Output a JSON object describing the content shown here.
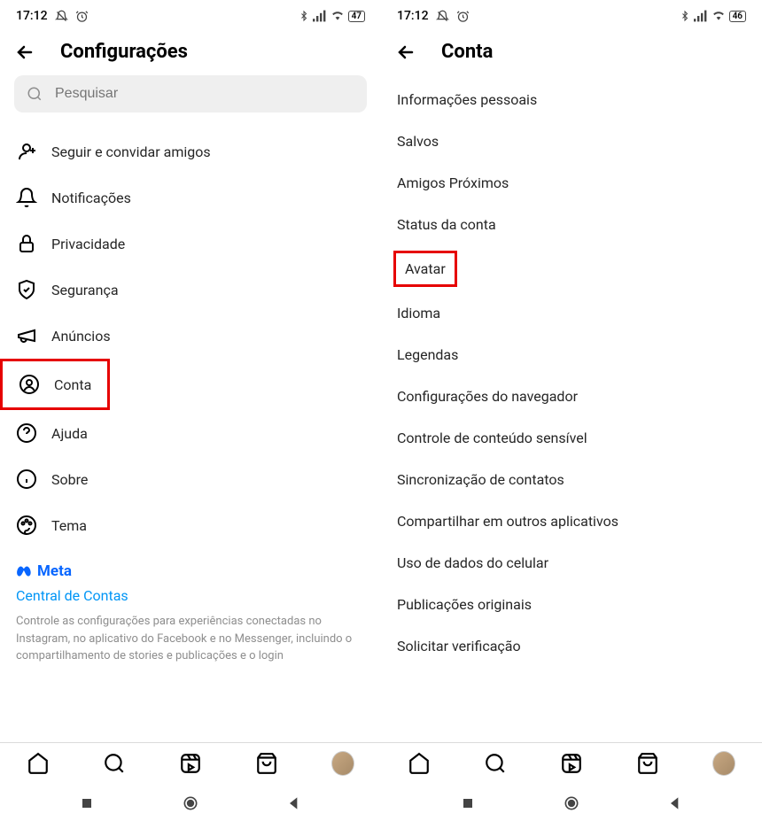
{
  "left": {
    "statusBar": {
      "time": "17:12",
      "battery": "47"
    },
    "header": {
      "title": "Configurações"
    },
    "search": {
      "placeholder": "Pesquisar"
    },
    "items": [
      {
        "icon": "follow-icon",
        "label": "Seguir e convidar amigos"
      },
      {
        "icon": "bell-icon",
        "label": "Notificações"
      },
      {
        "icon": "lock-icon",
        "label": "Privacidade"
      },
      {
        "icon": "shield-icon",
        "label": "Segurança"
      },
      {
        "icon": "megaphone-icon",
        "label": "Anúncios"
      },
      {
        "icon": "account-icon",
        "label": "Conta",
        "highlighted": true
      },
      {
        "icon": "help-icon",
        "label": "Ajuda"
      },
      {
        "icon": "info-icon",
        "label": "Sobre"
      },
      {
        "icon": "theme-icon",
        "label": "Tema"
      }
    ],
    "meta": {
      "logo": "Meta",
      "accountsCenter": "Central de Contas",
      "description": "Controle as configurações para experiências conectadas no Instagram, no aplicativo do Facebook e no Messenger, incluindo o compartilhamento de stories e publicações e o login"
    }
  },
  "right": {
    "statusBar": {
      "time": "17:12",
      "battery": "46"
    },
    "header": {
      "title": "Conta"
    },
    "items": [
      {
        "label": "Informações pessoais"
      },
      {
        "label": "Salvos"
      },
      {
        "label": "Amigos Próximos"
      },
      {
        "label": "Status da conta"
      },
      {
        "label": "Avatar",
        "highlighted": true
      },
      {
        "label": "Idioma"
      },
      {
        "label": "Legendas"
      },
      {
        "label": "Configurações do navegador"
      },
      {
        "label": "Controle de conteúdo sensível"
      },
      {
        "label": "Sincronização de contatos"
      },
      {
        "label": "Compartilhar em outros aplicativos"
      },
      {
        "label": "Uso de dados do celular"
      },
      {
        "label": "Publicações originais"
      },
      {
        "label": "Solicitar verificação"
      }
    ]
  }
}
